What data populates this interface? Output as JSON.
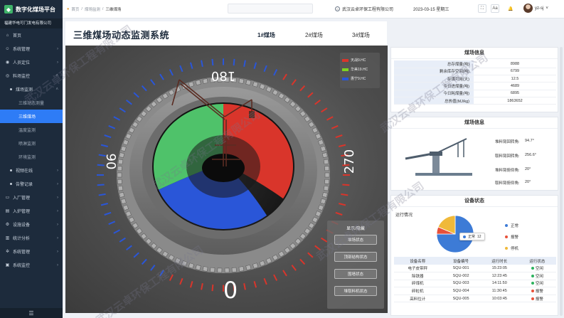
{
  "app": {
    "brand": "数字化煤场平台",
    "org": "福建华电可门发电有限公司"
  },
  "sidebar": {
    "items": [
      {
        "label": "首页",
        "icon": "home-icon"
      },
      {
        "label": "系统管理",
        "icon": "user-icon"
      },
      {
        "label": "人员定位",
        "icon": "location-icon"
      },
      {
        "label": "料场监控",
        "icon": "monitor-icon"
      }
    ],
    "sub_items": [
      {
        "label": "煤场监测"
      }
    ],
    "sub2_items": [
      {
        "label": "三维动态测量"
      },
      {
        "label": "三维煤场"
      },
      {
        "label": "温度监测"
      },
      {
        "label": "喷淋监测"
      },
      {
        "label": "环境监测"
      }
    ],
    "sub_items_b": [
      {
        "label": "视频在线"
      },
      {
        "label": "告警记录"
      }
    ],
    "lower_items": [
      {
        "label": "入厂管理",
        "icon": "truck-icon"
      },
      {
        "label": "入炉管理",
        "icon": "fire-icon"
      },
      {
        "label": "设施设备",
        "icon": "gear-icon"
      },
      {
        "label": "统计分析",
        "icon": "chart-icon"
      },
      {
        "label": "系统管理",
        "icon": "settings-icon"
      },
      {
        "label": "系统监控",
        "icon": "screen-icon"
      }
    ]
  },
  "breadcrumb": {
    "home": "首页",
    "sep": "/",
    "level1": "煤场监测",
    "current": "三维煤场"
  },
  "topbar": {
    "company": "武汉云卓环保工程有限公司",
    "datetime": "2023-03-15 星期三",
    "icons": [
      "fullscreen-icon",
      "font-size-icon",
      "bell-icon"
    ],
    "font_label": "Aa",
    "username": "yz-sj"
  },
  "page": {
    "title": "三维煤场动态监测系统",
    "tabs": [
      "1#煤场",
      "2#煤场",
      "3#煤场"
    ],
    "active_tab": 0
  },
  "scene": {
    "dial_labels": {
      "top": "180",
      "left": "90",
      "right": "270",
      "bottom": "0"
    },
    "legend": [
      {
        "label": "天战9.HC",
        "color": "#d9352b"
      },
      {
        "label": "华美19.HC",
        "color": "#7ed321"
      },
      {
        "label": "惠宁9.HC",
        "color": "#2a56d8"
      }
    ],
    "display_panel": {
      "title": "显示/隐藏",
      "buttons": [
        "堆场状态",
        "顶部结构状态",
        "围墙状态",
        "堆取料机状态"
      ]
    }
  },
  "coal_info": {
    "title": "煤场信息",
    "rows": [
      {
        "k": "总存煤量(吨)",
        "v": "8988"
      },
      {
        "k": "剩余库存空间(吨)",
        "v": "6799"
      },
      {
        "k": "存煤可用(天)",
        "v": "12.5"
      },
      {
        "k": "今日进煤量(吨)",
        "v": "4689"
      },
      {
        "k": "今日耗煤量(吨)",
        "v": "6895"
      },
      {
        "k": "总热值(MJ/kg)",
        "v": "1863652"
      }
    ]
  },
  "machine_info": {
    "title": "煤场信息",
    "rows": [
      {
        "k": "堆料臂回转角:",
        "v": "94.7°"
      },
      {
        "k": "取料臂回转角:",
        "v": "256.6°"
      },
      {
        "k": "堆料臂俯仰角:",
        "v": "20°"
      },
      {
        "k": "取料臂俯仰角:",
        "v": "20°"
      }
    ]
  },
  "device_status": {
    "title": "设备状态",
    "run_label": "运行情况",
    "pie": {
      "slices": [
        {
          "label": "正常",
          "value": 12,
          "color": "#3d7bd6"
        },
        {
          "label": "报警",
          "value": 1,
          "color": "#e8513a"
        },
        {
          "label": "停机",
          "value": 3,
          "color": "#f0b93a"
        }
      ],
      "tooltip": {
        "label": "正常",
        "value": "12"
      }
    },
    "columns": [
      "设备名称",
      "设备编号",
      "运行时长",
      "运行状态"
    ],
    "rows": [
      {
        "name": "电子皮带秤",
        "code": "SQU-001",
        "time": "15:23:05",
        "status": "空闲",
        "color": "#2cb35e"
      },
      {
        "name": "除铁器",
        "code": "SQU-002",
        "time": "12:23:45",
        "status": "空闲",
        "color": "#2cb35e"
      },
      {
        "name": "碎煤机",
        "code": "SQU-003",
        "time": "14:11:50",
        "status": "空闲",
        "color": "#2cb35e"
      },
      {
        "name": "碎粒机",
        "code": "SQU-004",
        "time": "11:30:45",
        "status": "报警",
        "color": "#e8513a"
      },
      {
        "name": "高料位计",
        "code": "SQU-005",
        "time": "10:03:45",
        "status": "报警",
        "color": "#e8513a"
      }
    ]
  },
  "watermark": "武汉云卓环保工程有限公司"
}
